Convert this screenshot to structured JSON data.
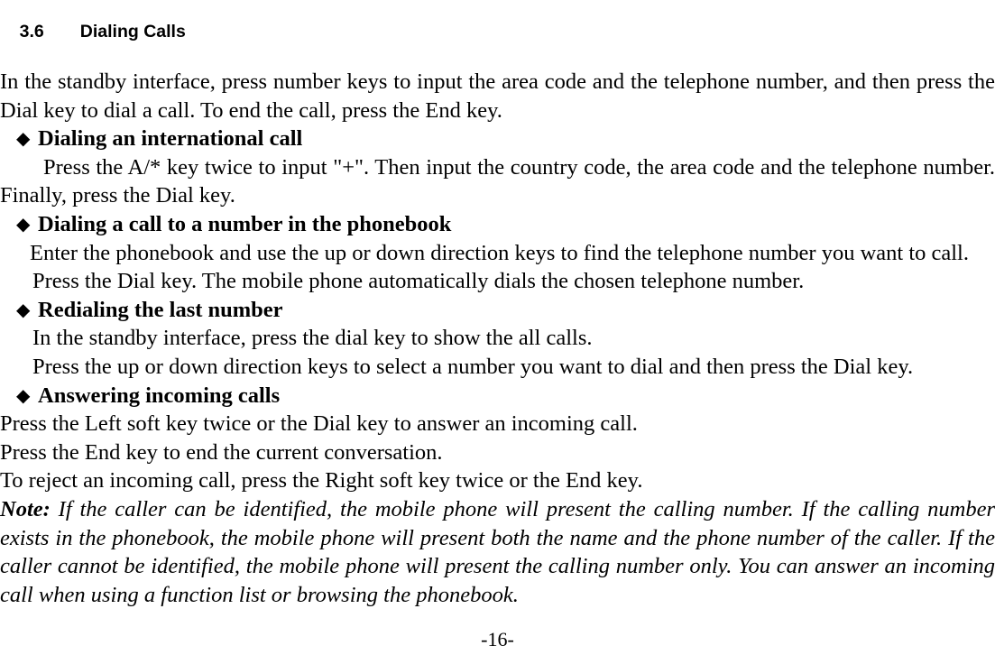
{
  "document": {
    "heading": {
      "number": "3.6",
      "title": "Dialing Calls"
    },
    "intro_paragraph": "In the standby interface, press number keys to input the area code and the telephone number, and then press the Dial key to dial a call. To end the call, press the End key.",
    "bullet_glyph": "◆",
    "sections": [
      {
        "heading": "Dialing an international call",
        "body": [
          "Press the A/* key twice to input \"+\". Then input the country code, the area code and the telephone number. Finally, press the Dial key."
        ]
      },
      {
        "heading": "Dialing a call to a number in the phonebook",
        "body": [
          "Enter the phonebook and use the up or down direction keys to find the telephone number you want to call.",
          "Press the Dial key. The mobile phone automatically dials the chosen telephone number."
        ]
      },
      {
        "heading": "Redialing the last number",
        "body": [
          "In the standby interface, press the dial key to show the all calls.",
          "Press the up or down direction keys to select a number you want to dial and then press the Dial key."
        ]
      },
      {
        "heading": "Answering incoming calls",
        "body": [
          "Press the Left soft key twice or the Dial key to answer an incoming call.",
          "Press the End key to end the current conversation.",
          "To reject an incoming call, press the Right soft key twice or the End key."
        ]
      }
    ],
    "note": {
      "label": "Note:",
      "text": "If the caller can be identified, the mobile phone will present the calling number. If the calling number exists in the phonebook, the mobile phone will present both the name and the phone number of the caller. If the caller cannot be identified, the mobile phone will present the calling number only. You can answer an incoming call when using a function list or browsing the phonebook."
    },
    "footer": {
      "page_number": "-16-"
    }
  }
}
